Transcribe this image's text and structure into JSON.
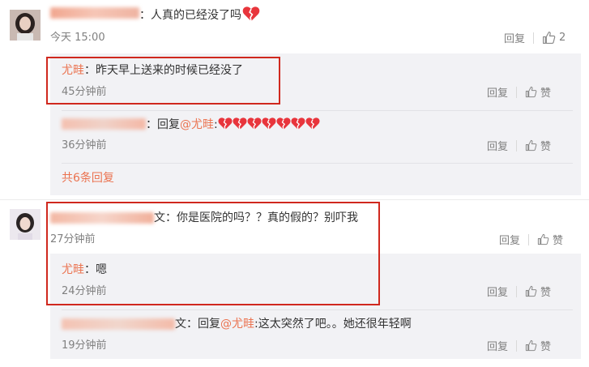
{
  "colors": {
    "accent": "#eb7350",
    "highlight_border": "#d0281e",
    "reply_bg": "#f2f2f5"
  },
  "c1": {
    "user_suffix": "：",
    "text": "人真的已经没了吗",
    "emoji": "broken-heart",
    "time": "今天 15:00",
    "reply_label": "回复",
    "like_count": "2",
    "replies": [
      {
        "user": "尤畦",
        "sep": "：",
        "text": "昨天早上送来的时候已经没了",
        "time": "45分钟前",
        "reply_label": "回复",
        "like_label": "赞"
      },
      {
        "prefix": "：回复",
        "mention": "@尤畦",
        "sep": ":",
        "emoji_count": 7,
        "time": "36分钟前",
        "reply_label": "回复",
        "like_label": "赞"
      }
    ],
    "more_replies": "共6条回复"
  },
  "c2": {
    "user_suffix": "文：",
    "text": "你是医院的吗？？真的假的？别吓我",
    "time": "27分钟前",
    "reply_label": "回复",
    "like_label": "赞",
    "replies": [
      {
        "user": "尤畦",
        "sep": "：",
        "text": "嗯",
        "time": "24分钟前",
        "reply_label": "回复",
        "like_label": "赞"
      },
      {
        "prefix": "文：回复",
        "mention": "@尤畦",
        "text": ":这太突然了吧。。她还很年轻啊",
        "time": "19分钟前",
        "reply_label": "回复",
        "like_label": "赞"
      }
    ]
  }
}
